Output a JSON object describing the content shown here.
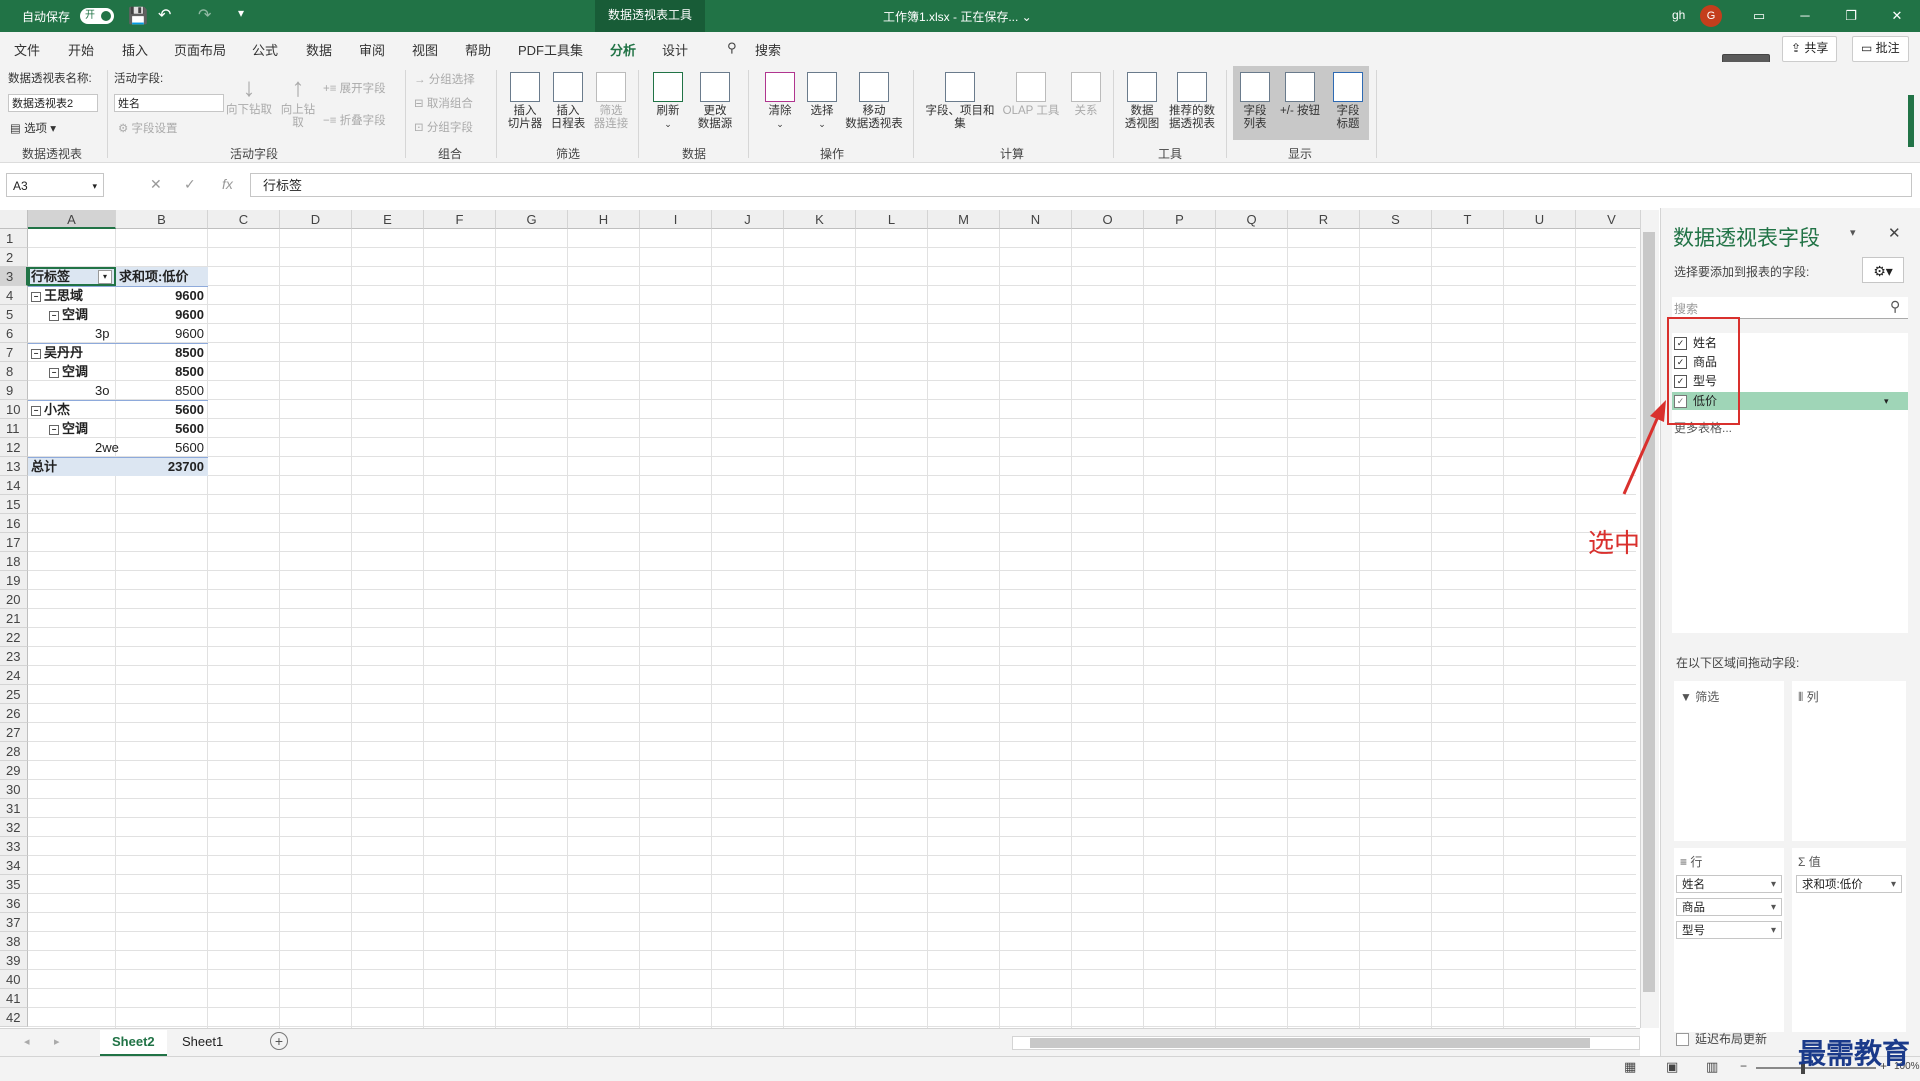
{
  "titlebar": {
    "autosave": "自动保存",
    "toggle": "开",
    "context_tab": "数据透视表工具",
    "filename": "工作簿1.xlsx  -  正在保存... ⌄",
    "user": "gh",
    "avatar": "G"
  },
  "menu": [
    "文件",
    "开始",
    "插入",
    "页面布局",
    "公式",
    "数据",
    "审阅",
    "视图",
    "帮助",
    "PDF工具集",
    "分析",
    "设计"
  ],
  "search": "搜索",
  "share": "共享",
  "comments": "批注",
  "ribbon": {
    "pivot_name_label": "数据透视表名称:",
    "pivot_name": "数据透视表2",
    "options": "选项",
    "active_field_label": "活动字段:",
    "active_field": "姓名",
    "field_settings": "字段设置",
    "drill_down": "向下钻取",
    "drill_up": "向上钻取",
    "expand": "展开字段",
    "collapse": "折叠字段",
    "group_sel": "分组选择",
    "ungroup": "取消组合",
    "group_field": "分组字段",
    "insert_slicer": "插入\n切片器",
    "insert_timeline": "插入\n日程表",
    "filter_conn": "筛选\n器连接",
    "refresh": "刷新",
    "change_source": "更改\n数据源",
    "clear": "清除",
    "select": "选择",
    "move": "移动\n数据透视表",
    "fields_items": "字段、项目和\n集",
    "olap": "OLAP 工具",
    "relations": "关系",
    "pivot_chart": "数据\n透视图",
    "recommended": "推荐的数\n据透视表",
    "field_list": "字段\n列表",
    "buttons": "+/- 按钮",
    "headers": "字段\n标题",
    "groups": [
      "数据透视表",
      "活动字段",
      "组合",
      "筛选",
      "数据",
      "操作",
      "计算",
      "工具",
      "显示"
    ]
  },
  "formula_bar": {
    "name_box": "A3",
    "formula": "行标签"
  },
  "columns": [
    "A",
    "B",
    "C",
    "D",
    "E",
    "F",
    "G",
    "H",
    "I",
    "J",
    "K",
    "L",
    "M",
    "N",
    "O",
    "P",
    "Q",
    "R",
    "S",
    "T",
    "U",
    "V"
  ],
  "rows": [
    "1",
    "2",
    "3",
    "4",
    "5",
    "6",
    "7",
    "8",
    "9",
    "10",
    "11",
    "12",
    "13",
    "14",
    "15",
    "16",
    "17",
    "18",
    "19",
    "20",
    "21",
    "22",
    "23",
    "24",
    "25",
    "26",
    "27",
    "28",
    "29",
    "30",
    "31",
    "32",
    "33",
    "34",
    "35",
    "36",
    "37",
    "38",
    "39",
    "40",
    "41",
    "42"
  ],
  "pivot": {
    "header_a": "行标签",
    "header_b": "求和项:低价",
    "rows": [
      {
        "label": "王思域",
        "value": "9600",
        "level": 0,
        "bold": true
      },
      {
        "label": "空调",
        "value": "9600",
        "level": 1,
        "bold": true
      },
      {
        "label": "3p",
        "value": "9600",
        "level": 2,
        "bold": false
      },
      {
        "label": "吴丹丹",
        "value": "8500",
        "level": 0,
        "bold": true
      },
      {
        "label": "空调",
        "value": "8500",
        "level": 1,
        "bold": true
      },
      {
        "label": "3o",
        "value": "8500",
        "level": 2,
        "bold": false
      },
      {
        "label": "小杰",
        "value": "5600",
        "level": 0,
        "bold": true
      },
      {
        "label": "空调",
        "value": "5600",
        "level": 1,
        "bold": true
      },
      {
        "label": "2we",
        "value": "5600",
        "level": 2,
        "bold": false
      }
    ],
    "total_label": "总计",
    "total_value": "23700"
  },
  "sheets": [
    "Sheet2",
    "Sheet1"
  ],
  "pane": {
    "title": "数据透视表字段",
    "subtitle": "选择要添加到报表的字段:",
    "search_placeholder": "搜索",
    "fields": [
      "姓名",
      "商品",
      "型号",
      "低价"
    ],
    "more_tables": "更多表格...",
    "drag_hint": "在以下区域间拖动字段:",
    "filters": "筛选",
    "columns": "列",
    "rows": "行",
    "values": "值",
    "row_fields": [
      "姓名",
      "商品",
      "型号"
    ],
    "value_fields": [
      "求和项:低价"
    ],
    "defer": "延迟布局更新"
  },
  "annotation": "选中",
  "watermark": "最需教育",
  "zoom": "100%"
}
